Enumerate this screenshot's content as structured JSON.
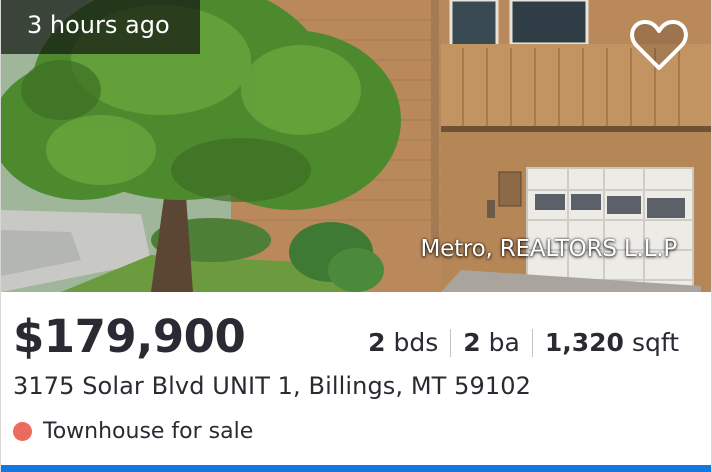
{
  "listing": {
    "time_ago": "3 hours ago",
    "brokerage": "Metro, REALTORS L.L.P",
    "price": "$179,900",
    "beds": {
      "value": "2",
      "unit": "bds"
    },
    "baths": {
      "value": "2",
      "unit": "ba"
    },
    "area": {
      "value": "1,320",
      "unit": "sqft"
    },
    "address": "3175 Solar Blvd UNIT 1, Billings, MT 59102",
    "status": "Townhouse for sale",
    "status_color": "#ec6a5e",
    "favorite_icon": "heart-outline-icon",
    "accent_color": "#1277e1"
  }
}
